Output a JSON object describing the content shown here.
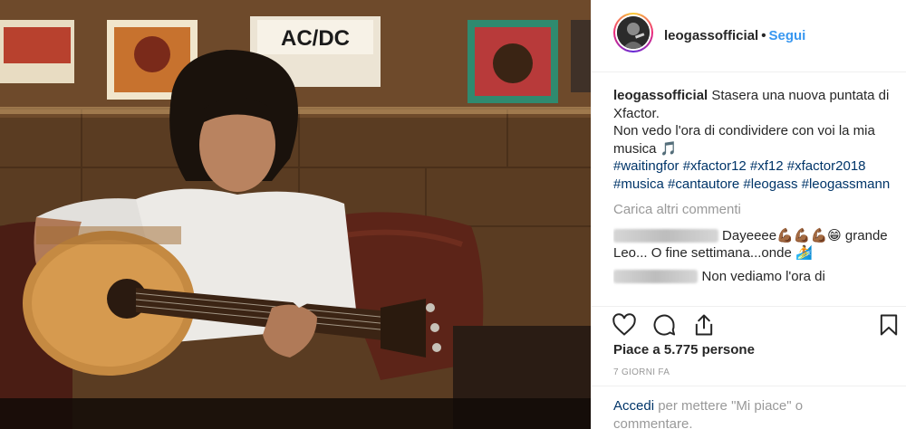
{
  "post": {
    "username": "leogassofficial",
    "separator": "•",
    "follow_label": "Segui",
    "avatar_icon": "profile-photo",
    "poster_text": "AC/DC"
  },
  "caption": {
    "username": "leogassofficial",
    "line1": "Stasera una nuova puntata di Xfactor.",
    "line2": "Non vedo l'ora di condividere con voi la mia musica",
    "emoji": "🎵",
    "hashtags": "#waitingfor #xfactor12 #xf12 #xfactor2018 #musica #cantautore #leogass #leogassmann"
  },
  "load_more_label": "Carica altri commenti",
  "comments": [
    {
      "username": "crissettifrancesca",
      "text": "Dayeeee💪🏾💪🏾💪🏾😁 grande Leo... O fine settimana...onde 🏄"
    },
    {
      "username": "cecilialacomia",
      "text": "Non vediamo l'ora di"
    }
  ],
  "actions": {
    "like_icon": "heart-icon",
    "comment_icon": "comment-icon",
    "share_icon": "share-icon",
    "save_icon": "bookmark-icon"
  },
  "likes_label": "Piace a 5.775 persone",
  "timestamp": "7 GIORNI FA",
  "login": {
    "link_label": "Accedi",
    "rest_label": "per mettere \"Mi piace\" o commentare."
  },
  "colors": {
    "link_blue": "#3897f0",
    "hashtag_blue": "#003569",
    "muted_gray": "#999999",
    "text_dark": "#262626"
  }
}
